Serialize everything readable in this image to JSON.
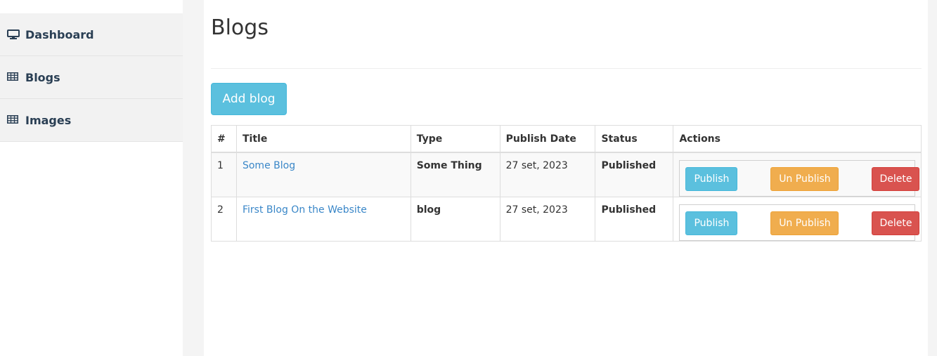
{
  "sidebar": {
    "items": [
      {
        "label": "Dashboard",
        "icon": "monitor-icon"
      },
      {
        "label": "Blogs",
        "icon": "table-icon"
      },
      {
        "label": "Images",
        "icon": "table-icon"
      }
    ]
  },
  "page": {
    "title": "Blogs",
    "add_button": "Add blog"
  },
  "table": {
    "headers": [
      "#",
      "Title",
      "Type",
      "Publish Date",
      "Status",
      "Actions"
    ],
    "rows": [
      {
        "num": "1",
        "title": "Some Blog",
        "type": "Some Thing",
        "date": "27 set, 2023",
        "status": "Published"
      },
      {
        "num": "2",
        "title": "First Blog On the Website",
        "type": "blog",
        "date": "27 set, 2023",
        "status": "Published"
      }
    ],
    "actions": {
      "publish": "Publish",
      "unpublish": "Un Publish",
      "delete": "Delete"
    }
  },
  "colors": {
    "info": "#5bc0de",
    "warning": "#f0ad4e",
    "danger": "#d9534f",
    "link": "#3a87c8",
    "sidebar_text": "#2a3f54"
  }
}
